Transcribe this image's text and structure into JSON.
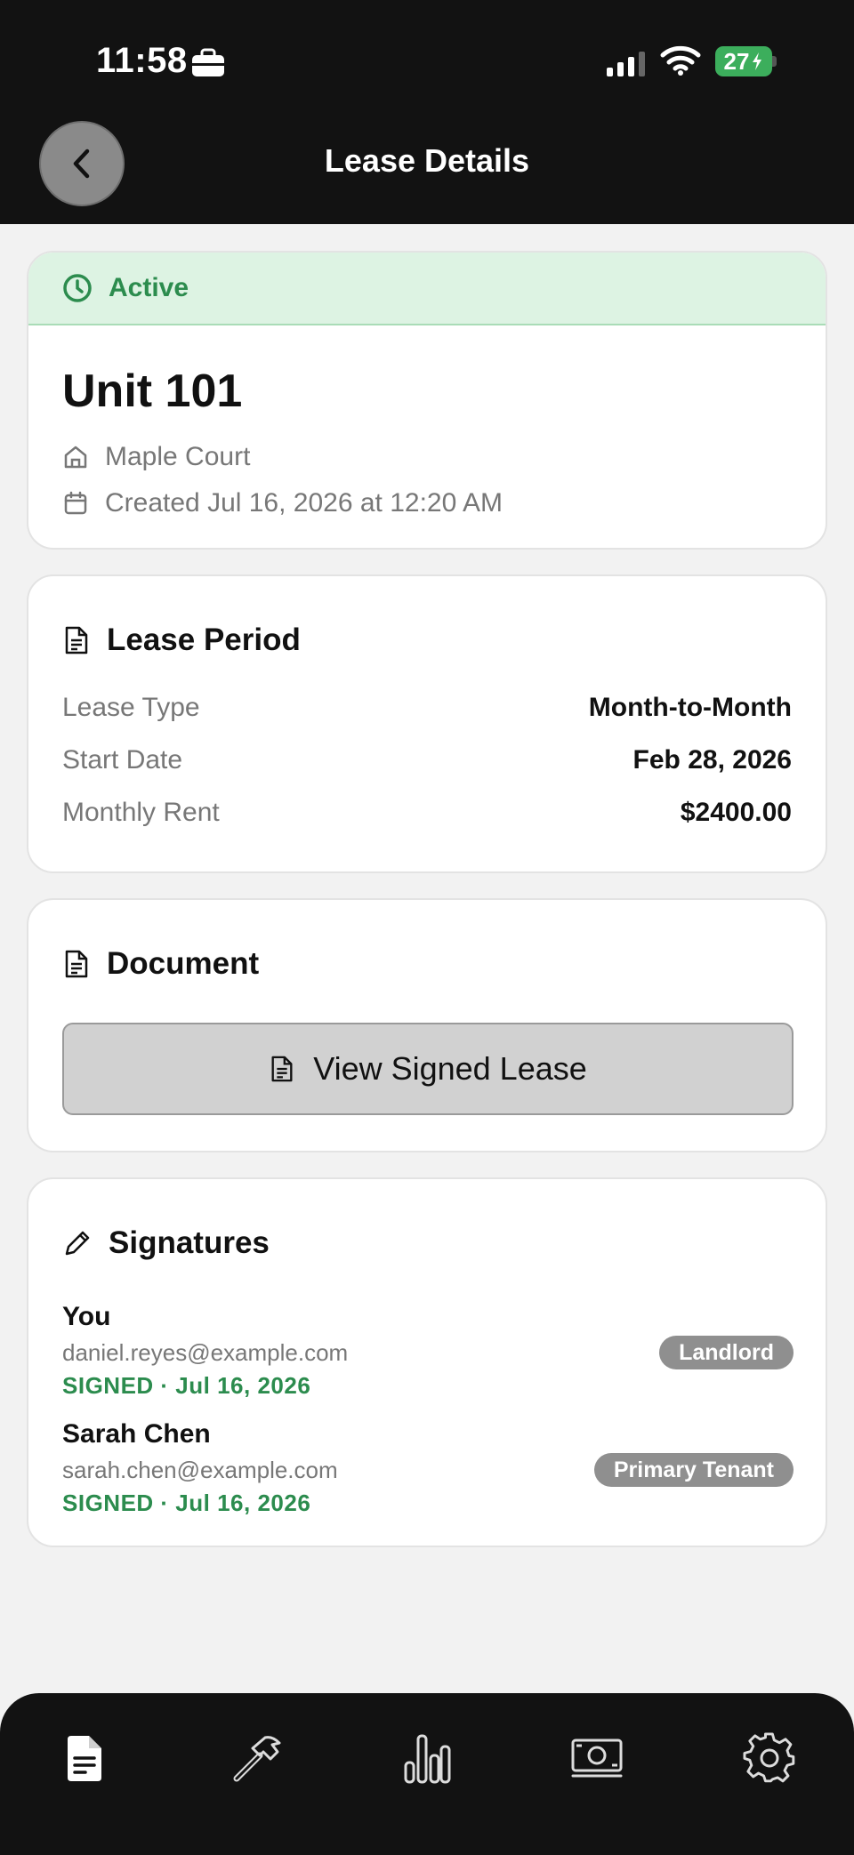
{
  "status_bar": {
    "time": "11:58",
    "battery": "27"
  },
  "header": {
    "title": "Lease Details"
  },
  "lease": {
    "status": "Active",
    "unit": "Unit 101",
    "property": "Maple Court",
    "created": "Created Jul 16, 2026 at 12:20 AM"
  },
  "period": {
    "heading": "Lease Period",
    "rows": [
      {
        "label": "Lease Type",
        "value": "Month-to-Month"
      },
      {
        "label": "Start Date",
        "value": "Feb 28, 2026"
      },
      {
        "label": "Monthly Rent",
        "value": "$2400.00"
      }
    ]
  },
  "document": {
    "heading": "Document",
    "button_label": "View Signed Lease"
  },
  "signatures": {
    "heading": "Signatures",
    "signers": [
      {
        "name": "You",
        "email": "daniel.reyes@example.com",
        "status": "SIGNED · Jul 16, 2026",
        "role": "Landlord"
      },
      {
        "name": "Sarah Chen",
        "email": "sarah.chen@example.com",
        "status": "SIGNED · Jul 16, 2026",
        "role": "Primary Tenant"
      }
    ]
  },
  "tabs": [
    {
      "icon": "document-icon",
      "active": true
    },
    {
      "icon": "hammer-icon",
      "active": false
    },
    {
      "icon": "bar-chart-icon",
      "active": false
    },
    {
      "icon": "money-icon",
      "active": false
    },
    {
      "icon": "gear-icon",
      "active": false
    }
  ],
  "colors": {
    "accent_green": "#2c8c4e",
    "status_bg": "#ddf3e3",
    "chrome": "#121212"
  }
}
